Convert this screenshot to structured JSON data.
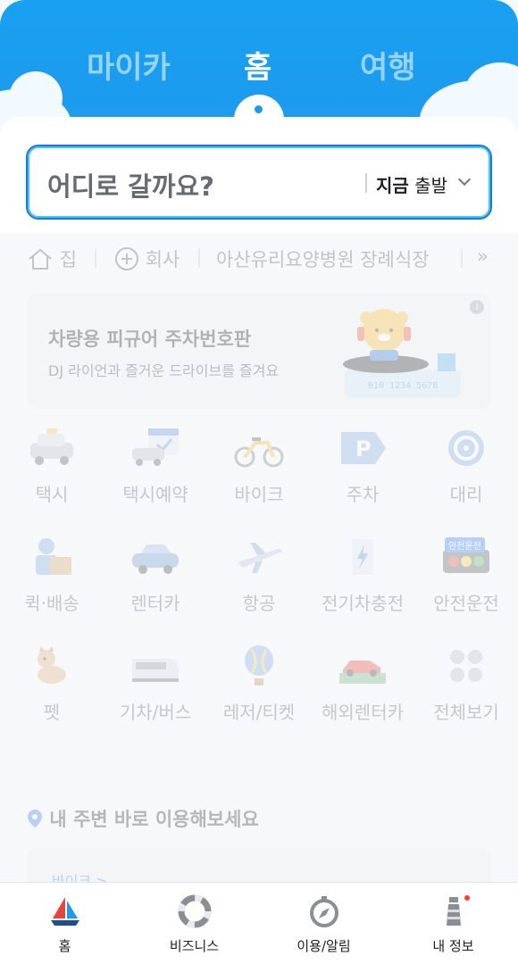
{
  "header": {
    "tabs": [
      {
        "label": "마이카"
      },
      {
        "label": "홈"
      },
      {
        "label": "여행"
      }
    ]
  },
  "search": {
    "placeholder": "어디로 갈까요?",
    "depart_bold": "지금",
    "depart_rest": " 출발"
  },
  "shortcuts": {
    "home": "집",
    "work": "회사",
    "recent": "아산유리요양병원 장례식장",
    "more": "»"
  },
  "banner": {
    "title": "차량용 피규어 주차번호판",
    "subtitle": "DJ 라이언과 즐거운 드라이브를 즐겨요",
    "plate_number": "010 1234 5678",
    "info_icon": "info-icon"
  },
  "services": [
    {
      "label": "택시",
      "icon": "taxi-icon"
    },
    {
      "label": "택시예약",
      "icon": "taxi-reservation-icon"
    },
    {
      "label": "바이크",
      "icon": "bike-icon"
    },
    {
      "label": "주차",
      "icon": "parking-icon"
    },
    {
      "label": "대리",
      "icon": "designated-driver-icon"
    },
    {
      "label": "퀵·배송",
      "icon": "delivery-icon"
    },
    {
      "label": "렌터카",
      "icon": "rental-car-icon"
    },
    {
      "label": "항공",
      "icon": "airplane-icon"
    },
    {
      "label": "전기차충전",
      "icon": "ev-charging-icon"
    },
    {
      "label": "안전운전",
      "icon": "safe-driving-icon",
      "badge": "안전운전"
    },
    {
      "label": "펫",
      "icon": "pet-icon"
    },
    {
      "label": "기차/버스",
      "icon": "train-bus-icon"
    },
    {
      "label": "레저/티켓",
      "icon": "balloon-icon"
    },
    {
      "label": "해외렌터카",
      "icon": "overseas-rental-icon"
    },
    {
      "label": "전체보기",
      "icon": "all-services-icon"
    }
  ],
  "nearby": {
    "title": "내 주변 바로 이용해보세요",
    "card_link": "바이크 >"
  },
  "bottom_nav": [
    {
      "label": "홈",
      "icon": "sailboat-icon"
    },
    {
      "label": "비즈니스",
      "icon": "lifebuoy-icon"
    },
    {
      "label": "이용/알림",
      "icon": "compass-icon"
    },
    {
      "label": "내 정보",
      "icon": "lighthouse-icon"
    }
  ],
  "colors": {
    "header_blue": "#1b9bee",
    "search_border": "#1f76d8",
    "link_blue": "#2e7cf6",
    "notification_dot": "#ff3b30"
  }
}
